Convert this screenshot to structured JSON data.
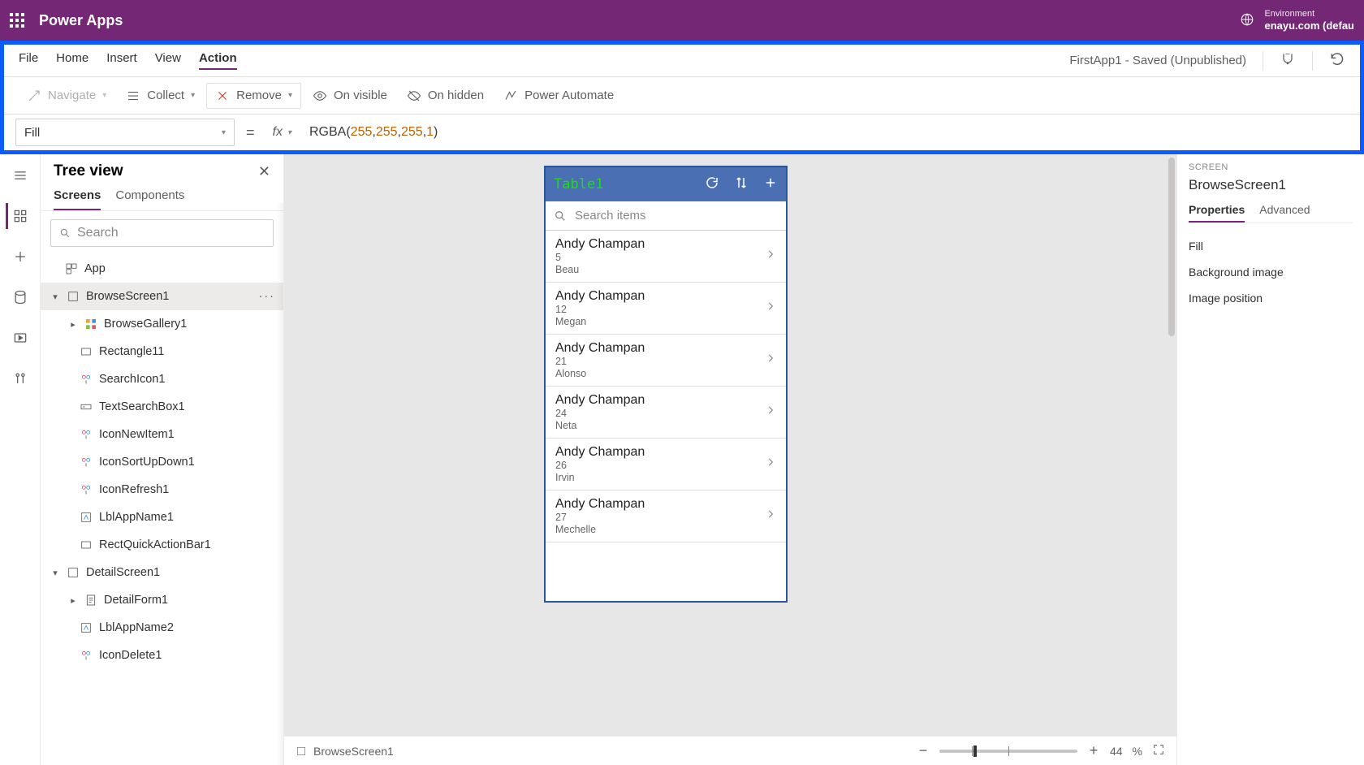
{
  "header": {
    "app_name": "Power Apps",
    "env_label": "Environment",
    "env_name": "enayu.com (defau"
  },
  "menu": {
    "items": [
      "File",
      "Home",
      "Insert",
      "View",
      "Action"
    ],
    "active_index": 4,
    "doc_status": "FirstApp1 - Saved (Unpublished)"
  },
  "ribbon": {
    "navigate": "Navigate",
    "collect": "Collect",
    "remove": "Remove",
    "on_visible": "On visible",
    "on_hidden": "On hidden",
    "power_automate": "Power Automate"
  },
  "formula": {
    "property": "Fill",
    "tokens": {
      "fn": "RGBA",
      "open": "(",
      "n1": "255",
      "c1": ", ",
      "n2": "255",
      "c2": ", ",
      "n3": "255",
      "c3": ", ",
      "n4": "1",
      "close": ")"
    }
  },
  "tree": {
    "title": "Tree view",
    "tabs": {
      "screens": "Screens",
      "components": "Components"
    },
    "search_placeholder": "Search",
    "nodes": {
      "app": "App",
      "browse_screen": "BrowseScreen1",
      "browse_gallery": "BrowseGallery1",
      "rectangle11": "Rectangle11",
      "search_icon": "SearchIcon1",
      "text_search": "TextSearchBox1",
      "icon_new": "IconNewItem1",
      "icon_sort": "IconSortUpDown1",
      "icon_refresh": "IconRefresh1",
      "lbl_app1": "LblAppName1",
      "rect_quick": "RectQuickActionBar1",
      "detail_screen": "DetailScreen1",
      "detail_form": "DetailForm1",
      "lbl_app2": "LblAppName2",
      "icon_delete": "IconDelete1"
    }
  },
  "phone": {
    "title": "Table1",
    "search_placeholder": "Search items",
    "rows": [
      {
        "title": "Andy Champan",
        "sub1": "5",
        "sub2": "Beau"
      },
      {
        "title": "Andy Champan",
        "sub1": "12",
        "sub2": "Megan"
      },
      {
        "title": "Andy Champan",
        "sub1": "21",
        "sub2": "Alonso"
      },
      {
        "title": "Andy Champan",
        "sub1": "24",
        "sub2": "Neta"
      },
      {
        "title": "Andy Champan",
        "sub1": "26",
        "sub2": "Irvin"
      },
      {
        "title": "Andy Champan",
        "sub1": "27",
        "sub2": "Mechelle"
      }
    ]
  },
  "status": {
    "screen_name": "BrowseScreen1",
    "zoom_value": "44",
    "zoom_pct": "%"
  },
  "props": {
    "kicker": "SCREEN",
    "title": "BrowseScreen1",
    "tabs": {
      "properties": "Properties",
      "advanced": "Advanced"
    },
    "rows": {
      "fill": "Fill",
      "bg": "Background image",
      "imgpos": "Image position"
    }
  }
}
